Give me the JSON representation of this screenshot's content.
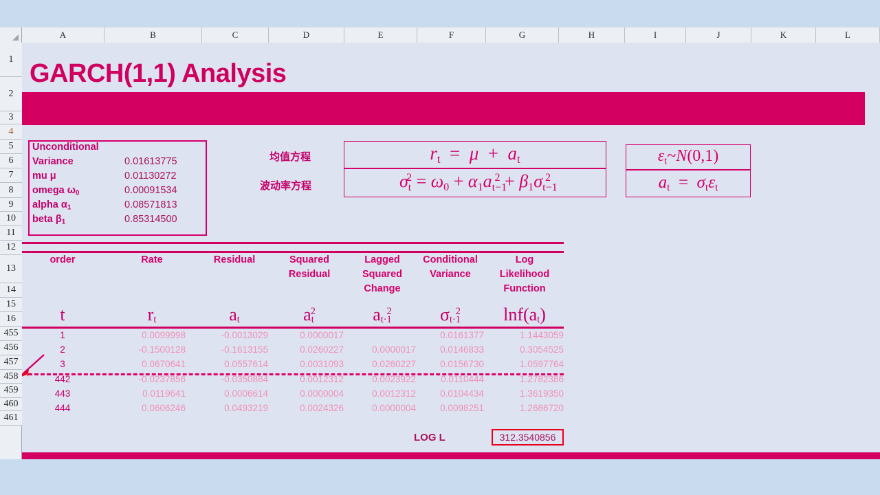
{
  "sheet": {
    "columns": [
      "A",
      "B",
      "C",
      "D",
      "E",
      "F",
      "G",
      "H",
      "I",
      "J",
      "K",
      "L"
    ],
    "rows": [
      "1",
      "2",
      "3",
      "4",
      "5",
      "6",
      "7",
      "8",
      "9",
      "10",
      "11",
      "12",
      "13",
      "14",
      "15",
      "16",
      "455",
      "456",
      "457",
      "458",
      "459",
      "460",
      "461"
    ],
    "highlighted_row": "4"
  },
  "title": "GARCH(1,1) Analysis",
  "params": {
    "rows": [
      {
        "label": "Unconditional",
        "label2": " Variance",
        "value": "0.01613775"
      },
      {
        "label": "mu μ",
        "value": "0.01130272"
      },
      {
        "label": "omega ω",
        "sub": "0",
        "value": "0.00091534"
      },
      {
        "label": "alpha α",
        "sub": "1",
        "value": "0.08571813"
      },
      {
        "label": "beta β",
        "sub": "1",
        "value": "0.85314500"
      }
    ]
  },
  "equations": {
    "mean_label": "均值方程",
    "vol_label": "波动率方程",
    "mean": "r_t = μ + a_t",
    "vol": "σ²_t = ω₀ + α₁ a²_(t−1) + β₁ σ²_(t−1)",
    "eps": "ε_t ~ N(0,1)",
    "at": "a_t = σ_t ε_t"
  },
  "table": {
    "headers": [
      {
        "line1": "order",
        "line2": "",
        "line3": ""
      },
      {
        "line1": "Rate",
        "line2": "",
        "line3": ""
      },
      {
        "line1": "Residual",
        "line2": "",
        "line3": ""
      },
      {
        "line1": "Squared",
        "line2": "Residual",
        "line3": ""
      },
      {
        "line1": "Lagged",
        "line2": "Squared",
        "line3": "Change"
      },
      {
        "line1": "Conditional",
        "line2": "Variance",
        "line3": ""
      },
      {
        "line1": "Log",
        "line2": "Likelihood",
        "line3": "Function"
      }
    ],
    "symbols": [
      "t",
      "r_t",
      "a_t",
      "a_t²",
      "a_{t-1}²",
      "σ_{t-1}²",
      "lnf(a_t)"
    ],
    "rows_top": [
      {
        "order": "1",
        "rate": "0.0099998",
        "residual": "-0.0013029",
        "sq_res": "0.0000017",
        "lag_sq": "",
        "cond_var": "0.0161377",
        "loglik": "1.1443059"
      },
      {
        "order": "2",
        "rate": "-0.1500128",
        "residual": "-0.1613155",
        "sq_res": "0.0260227",
        "lag_sq": "0.0000017",
        "cond_var": "0.0146833",
        "loglik": "0.3054525"
      },
      {
        "order": "3",
        "rate": "0.0670641",
        "residual": "0.0557614",
        "sq_res": "0.0031093",
        "lag_sq": "0.0260227",
        "cond_var": "0.0156730",
        "loglik": "1.0597764"
      }
    ],
    "rows_bottom": [
      {
        "order": "442",
        "rate": "-0.0237856",
        "residual": "-0.0350884",
        "sq_res": "0.0012312",
        "lag_sq": "0.0023922",
        "cond_var": "0.0110444",
        "loglik": "1.2782386"
      },
      {
        "order": "443",
        "rate": "0.0119641",
        "residual": "0.0006614",
        "sq_res": "0.0000004",
        "lag_sq": "0.0012312",
        "cond_var": "0.0104434",
        "loglik": "1.3619350"
      },
      {
        "order": "444",
        "rate": "0.0606246",
        "residual": "0.0493219",
        "sq_res": "0.0024326",
        "lag_sq": "0.0000004",
        "cond_var": "0.0098251",
        "loglik": "1.2686720"
      }
    ]
  },
  "footer": {
    "logl_label": "LOG L",
    "logl_value": "312.3540856"
  },
  "colors": {
    "magenta": "#d30061",
    "pink_text": "#c4006a",
    "data_pink": "#f191b9",
    "red_border": "#e8001a",
    "sheet_bg": "#dde3f0",
    "page_bg": "#c9dcef"
  }
}
